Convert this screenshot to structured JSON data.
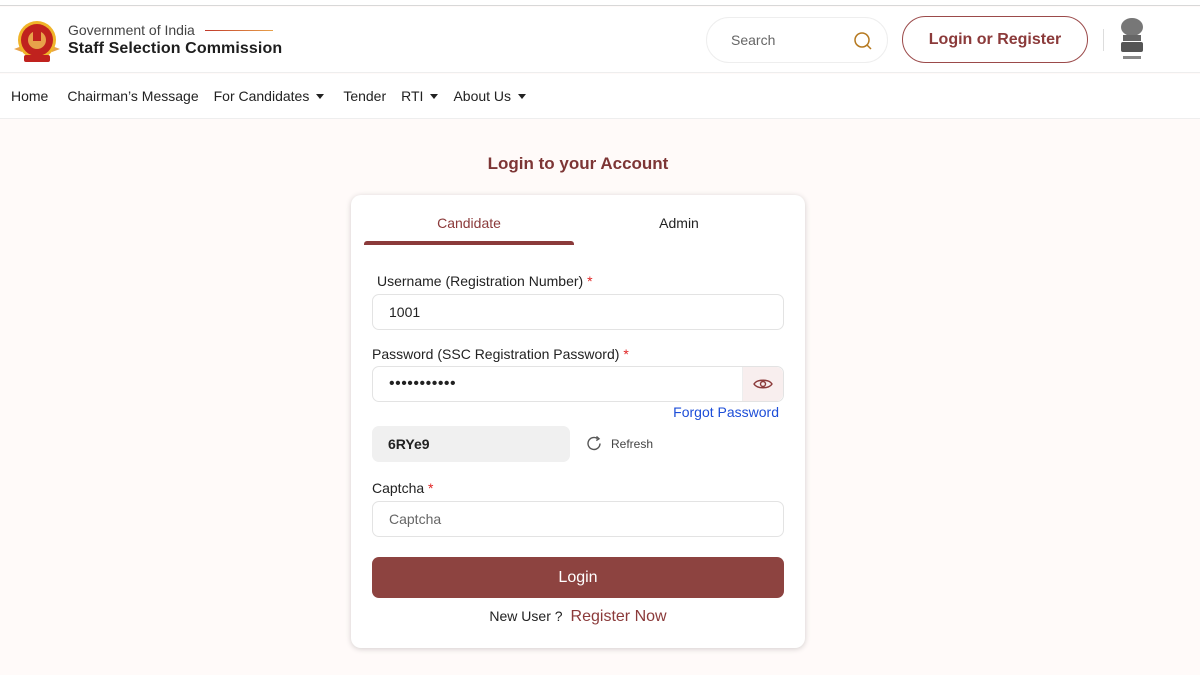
{
  "header": {
    "gov_label": "Government of India",
    "org_name": "Staff Selection Commission",
    "search": {
      "placeholder": "Search",
      "value": ""
    },
    "login_register_label": "Login or Register"
  },
  "nav": {
    "items": [
      {
        "label": "Home",
        "dropdown": false
      },
      {
        "label": "Chairman’s Message",
        "dropdown": false
      },
      {
        "label": "For Candidates",
        "dropdown": true
      },
      {
        "label": "Tender",
        "dropdown": false
      },
      {
        "label": "RTI",
        "dropdown": true
      },
      {
        "label": "About Us",
        "dropdown": true
      }
    ]
  },
  "login": {
    "title": "Login to your Account",
    "tabs": [
      {
        "label": "Candidate",
        "active": true
      },
      {
        "label": "Admin",
        "active": false
      }
    ],
    "username_label": "Username (Registration Number)",
    "username_value": "1001",
    "password_label": "Password (SSC Registration Password)",
    "password_value": "•••••••••••",
    "required_mark": "*",
    "forgot_password": "Forgot Password",
    "captcha_code": "6RYe9",
    "refresh_label": "Refresh",
    "captcha_label": "Captcha",
    "captcha_placeholder": "Captcha",
    "captcha_value": "",
    "login_button": "Login",
    "new_user_text": "New User ?",
    "register_now": "Register Now"
  },
  "colors": {
    "brand_maroon": "#8b3a3a",
    "login_button": "#8d4340",
    "link_blue": "#1d4ed8",
    "required_red": "#e02424",
    "page_bg": "#fffaf9"
  }
}
